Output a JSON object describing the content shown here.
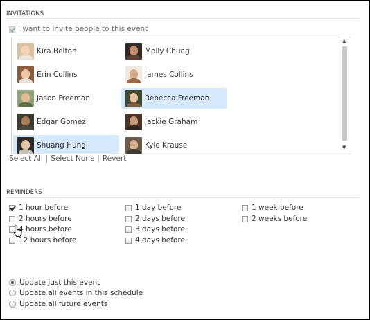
{
  "invitations": {
    "section_title": "INVITATIONS",
    "invite_checkbox": {
      "label": "I want to invite people to this event",
      "checked": true,
      "disabled": true
    },
    "people": [
      {
        "name": "Kira Belton",
        "selected": false
      },
      {
        "name": "Molly Chung",
        "selected": false
      },
      {
        "name": "Erin Collins",
        "selected": false
      },
      {
        "name": "James Collins",
        "selected": false
      },
      {
        "name": "Jason Freeman",
        "selected": false
      },
      {
        "name": "Rebecca Freeman",
        "selected": true
      },
      {
        "name": "Edgar Gomez",
        "selected": false
      },
      {
        "name": "Jackie Graham",
        "selected": false
      },
      {
        "name": "Shuang Hung",
        "selected": true
      },
      {
        "name": "Kyle Krause",
        "selected": false
      }
    ],
    "actions": {
      "select_all": "Select All",
      "select_none": "Select None",
      "revert": "Revert",
      "separator": "|"
    }
  },
  "reminders": {
    "section_title": "REMINDERS",
    "options": [
      {
        "label": "1 hour before",
        "checked": true
      },
      {
        "label": "2 hours before",
        "checked": false
      },
      {
        "label": "4 hours before",
        "checked": false
      },
      {
        "label": "12 hours before",
        "checked": false
      },
      {
        "label": "1 day before",
        "checked": false
      },
      {
        "label": "2 days before",
        "checked": false
      },
      {
        "label": "3 days before",
        "checked": false
      },
      {
        "label": "4 days before",
        "checked": false
      },
      {
        "label": "1 week before",
        "checked": false
      },
      {
        "label": "2 weeks before",
        "checked": false
      }
    ]
  },
  "update_scope": {
    "options": [
      {
        "label": "Update just this event",
        "selected": true
      },
      {
        "label": "Update all events in this schedule",
        "selected": false
      },
      {
        "label": "Update all future events",
        "selected": false
      }
    ]
  },
  "icons": {
    "scroll_up": "scroll-up-arrow-icon",
    "scroll_down": "scroll-down-arrow-icon",
    "cursor": "hand-pointer-icon"
  },
  "colors": {
    "selection": "#d6e8fb",
    "scroll_thumb": "#c8c8c8",
    "frame_border": "#000000"
  }
}
